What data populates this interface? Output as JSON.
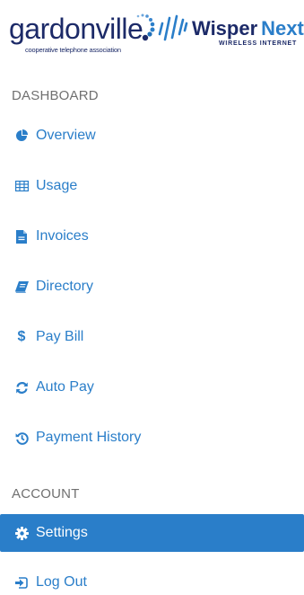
{
  "logos": {
    "gardonville": {
      "name": "gardonville",
      "tagline": "cooperative telephone association"
    },
    "wisper": {
      "name_primary": "Wisper",
      "name_secondary": "Next",
      "tagline": "WIRELESS INTERNET"
    }
  },
  "sections": {
    "dashboard": {
      "header": "DASHBOARD",
      "items": [
        {
          "label": "Overview",
          "icon": "pie-chart-icon"
        },
        {
          "label": "Usage",
          "icon": "table-icon"
        },
        {
          "label": "Invoices",
          "icon": "file-text-icon"
        },
        {
          "label": "Directory",
          "icon": "book-icon"
        },
        {
          "label": "Pay Bill",
          "icon": "dollar-icon"
        },
        {
          "label": "Auto Pay",
          "icon": "refresh-icon"
        },
        {
          "label": "Payment History",
          "icon": "history-icon"
        }
      ]
    },
    "account": {
      "header": "ACCOUNT",
      "items": [
        {
          "label": "Settings",
          "icon": "gear-icon",
          "active": true
        },
        {
          "label": "Log Out",
          "icon": "sign-out-icon"
        }
      ]
    }
  },
  "colors": {
    "accent": "#2a7ec9",
    "active_bg": "#2a7ec9",
    "header_text": "#707070",
    "brand_navy": "#1c2a68"
  }
}
